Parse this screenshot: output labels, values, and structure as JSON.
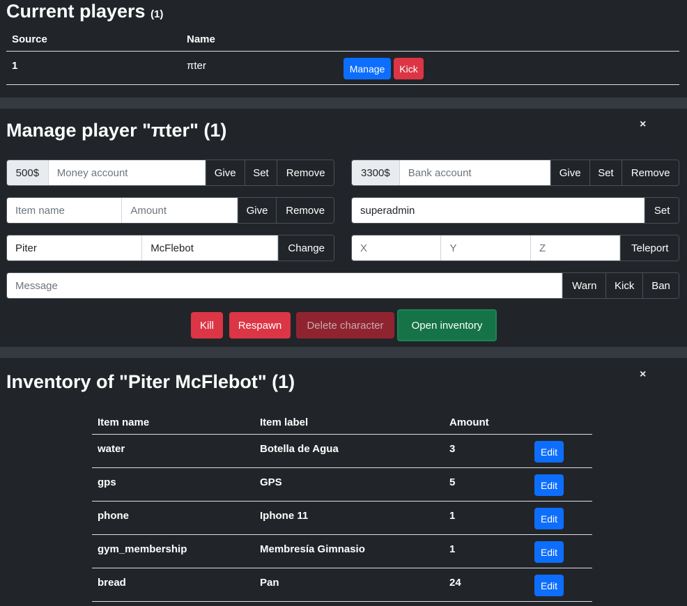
{
  "current_players": {
    "title": "Current players",
    "count": "(1)",
    "columns": [
      "Source",
      "Name"
    ],
    "rows": [
      {
        "source": "1",
        "name": "πter",
        "manage_label": "Manage",
        "kick_label": "Kick"
      }
    ]
  },
  "manage": {
    "title": "Manage player \"πter\" (1)",
    "close": "×",
    "money": {
      "value": "500$",
      "placeholder": "Money account",
      "give": "Give",
      "set": "Set",
      "remove": "Remove"
    },
    "bank": {
      "value": "3300$",
      "placeholder": "Bank account",
      "give": "Give",
      "set": "Set",
      "remove": "Remove"
    },
    "item": {
      "name_placeholder": "Item name",
      "amount_placeholder": "Amount",
      "give": "Give",
      "remove": "Remove"
    },
    "group": {
      "value": "superadmin",
      "set": "Set"
    },
    "name": {
      "first": "Piter",
      "last": "McFlebot",
      "change": "Change"
    },
    "coords": {
      "x": "X",
      "y": "Y",
      "z": "Z",
      "teleport": "Teleport"
    },
    "message": {
      "placeholder": "Message",
      "warn": "Warn",
      "kick": "Kick",
      "ban": "Ban"
    },
    "actions": {
      "kill": "Kill",
      "respawn": "Respawn",
      "delete": "Delete character",
      "inventory": "Open inventory"
    }
  },
  "inventory": {
    "title": "Inventory of \"Piter McFlebot\" (1)",
    "close": "×",
    "columns": [
      "Item name",
      "Item label",
      "Amount"
    ],
    "rows": [
      {
        "name": "water",
        "label": "Botella de Agua",
        "amount": "3",
        "edit": "Edit"
      },
      {
        "name": "gps",
        "label": "GPS",
        "amount": "5",
        "edit": "Edit"
      },
      {
        "name": "phone",
        "label": "Iphone 11",
        "amount": "1",
        "edit": "Edit"
      },
      {
        "name": "gym_membership",
        "label": "Membresía Gimnasio",
        "amount": "1",
        "edit": "Edit"
      },
      {
        "name": "bread",
        "label": "Pan",
        "amount": "24",
        "edit": "Edit"
      }
    ]
  },
  "colors": {
    "background": "#212529",
    "separator": "#343a40",
    "primary": "#0d6efd",
    "danger": "#dc3545",
    "success": "#157347"
  }
}
